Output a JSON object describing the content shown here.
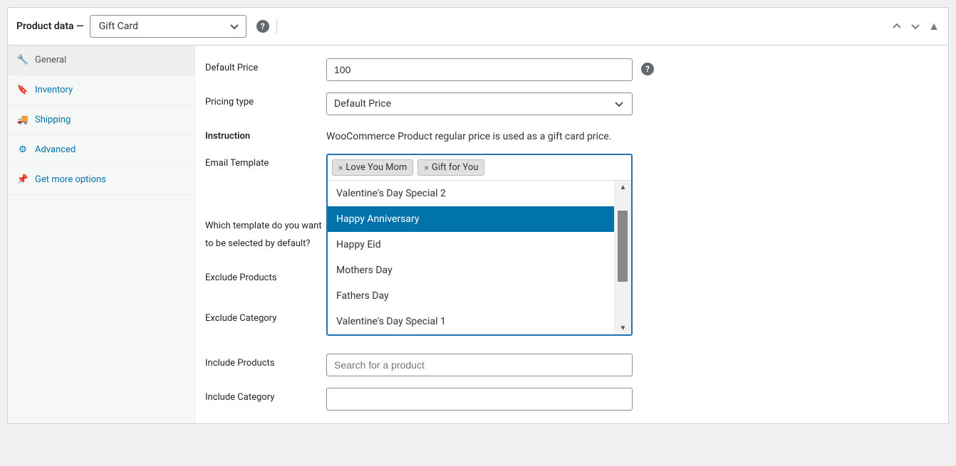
{
  "header": {
    "title": "Product data —",
    "product_type": "Gift Card"
  },
  "sidebar": {
    "items": [
      {
        "label": "General",
        "icon": "wrench",
        "active": true
      },
      {
        "label": "Inventory",
        "icon": "tag",
        "active": false
      },
      {
        "label": "Shipping",
        "icon": "truck",
        "active": false
      },
      {
        "label": "Advanced",
        "icon": "gear",
        "active": false
      },
      {
        "label": "Get more options",
        "icon": "pin",
        "active": false
      }
    ]
  },
  "form": {
    "default_price": {
      "label": "Default Price",
      "value": "100"
    },
    "pricing_type": {
      "label": "Pricing type",
      "value": "Default Price"
    },
    "instruction": {
      "label": "Instruction",
      "text": "WooCommerce Product regular price is used as a gift card price."
    },
    "email_template": {
      "label": "Email Template",
      "selected": [
        "Love You Mom",
        "Gift for You"
      ],
      "options": [
        {
          "label": "Valentine's Day Special 2",
          "highlighted": false
        },
        {
          "label": "Happy Anniversary",
          "highlighted": true
        },
        {
          "label": "Happy Eid",
          "highlighted": false
        },
        {
          "label": "Mothers Day",
          "highlighted": false
        },
        {
          "label": "Fathers Day",
          "highlighted": false
        },
        {
          "label": "Valentine's Day Special 1",
          "highlighted": false
        }
      ]
    },
    "which_template": {
      "label": "Which template do you want to be selected by default?"
    },
    "exclude_products": {
      "label": "Exclude Products"
    },
    "exclude_category": {
      "label": "Exclude Category"
    },
    "include_products": {
      "label": "Include Products",
      "placeholder": "Search for a product"
    },
    "include_category": {
      "label": "Include Category"
    }
  }
}
